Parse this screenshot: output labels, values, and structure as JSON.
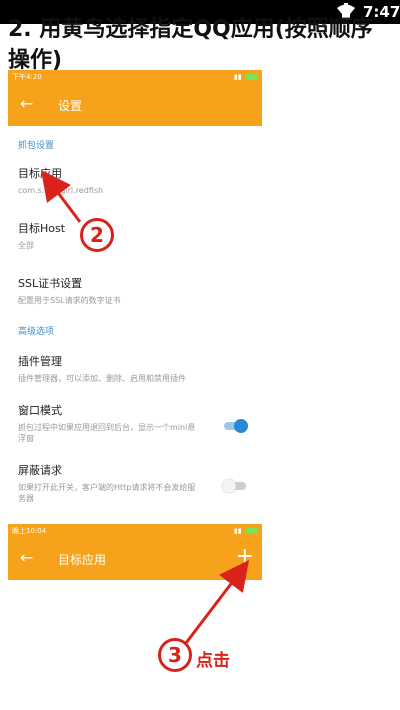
{
  "system_bar": {
    "time": "7:47"
  },
  "heading": "2. 用黄鸟选择指定QQ应用(按照顺序操作)",
  "settings_screen": {
    "status_time": "下午4:20",
    "title": "设置",
    "section_capture": "抓包设置",
    "items": [
      {
        "title": "目标应用",
        "subtitle": "com.s…….girl.redfish"
      },
      {
        "title": "目标Host",
        "subtitle": "全部"
      },
      {
        "title": "SSL证书设置",
        "subtitle": "配置用于SSL请求的数字证书"
      }
    ],
    "section_advanced": "高级选项",
    "advanced": [
      {
        "title": "插件管理",
        "subtitle": "插件管理器，可以添加、删除、启用和禁用插件"
      },
      {
        "title": "窗口模式",
        "subtitle": "抓包过程中如果应用退回到后台，显示一个mini悬浮窗",
        "toggle": "on"
      },
      {
        "title": "屏蔽请求",
        "subtitle": "如果打开此开关，客户端的Http请求将不会发给服务器",
        "toggle": "off"
      }
    ]
  },
  "target_screen": {
    "status_time": "晚上10:04",
    "title": "目标应用",
    "add_symbol": "+"
  },
  "markers": {
    "step2": "2",
    "step3": "3",
    "click_label": "点击"
  },
  "colors": {
    "accent": "#F7A21B",
    "annotation": "#D9231A",
    "section": "#3A8FCC",
    "toggle_on": "#2C86D6"
  }
}
